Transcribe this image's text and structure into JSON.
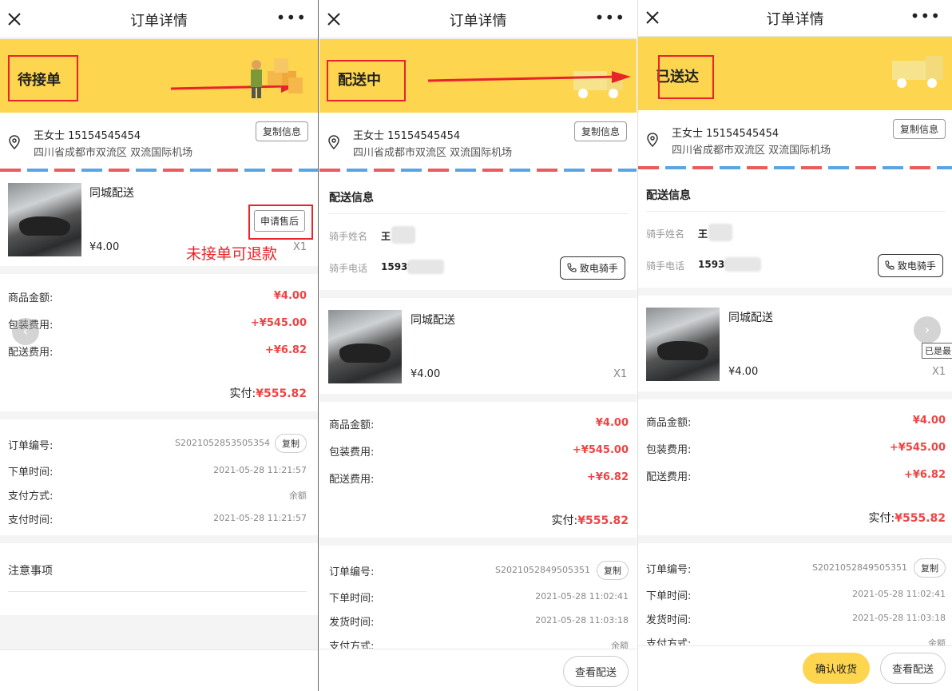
{
  "header": {
    "title": "订单详情",
    "more": "•••"
  },
  "addr": {
    "name": "王女士 15154545454",
    "location": "四川省成都市双流区 双流国际机场",
    "copy_info": "复制信息"
  },
  "product": {
    "name": "同城配送",
    "price": "¥4.00",
    "qty": "X1"
  },
  "amounts": {
    "goods_label": "商品金额:",
    "goods": "¥4.00",
    "pack_label": "包装费用:",
    "pack": "+¥545.00",
    "ship_label": "配送费用:",
    "ship": "+¥6.82",
    "paid_label": "实付:",
    "paid": "¥555.82"
  },
  "labels": {
    "order_no": "订单编号:",
    "order_time": "下单时间:",
    "pay_method": "支付方式:",
    "pay_time": "支付时间:",
    "ship_time": "发货时间:",
    "copy": "复制",
    "delivery_info": "配送信息",
    "rider_name": "骑手姓名",
    "rider_phone": "骑手电话",
    "call_rider": "致电骑手",
    "view_delivery": "查看配送",
    "confirm_receipt": "确认收货",
    "notes": "注意事项"
  },
  "panel1": {
    "status": "待接单",
    "after_sale": "申请售后",
    "annotation": "未接单可退款",
    "order_no": "S2021052853505354",
    "order_time": "2021-05-28 11:21:57",
    "pay_method": "余额",
    "pay_time": "2021-05-28 11:21:57",
    "nav_left": "‹"
  },
  "panel2": {
    "status": "配送中",
    "rider_name": "王",
    "rider_phone": "15939",
    "order_no": "S2021052849505351",
    "order_time": "2021-05-28 11:02:41",
    "ship_time": "2021-05-28 11:03:18",
    "pay_method": "余额"
  },
  "panel3": {
    "status": "已送达",
    "rider_name": "王",
    "rider_phone": "15939",
    "order_no": "S2021052849505351",
    "order_time": "2021-05-28 11:02:41",
    "ship_time": "2021-05-28 11:03:18",
    "pay_method": "余额",
    "nav_right": "›",
    "tooltip": "已是最"
  },
  "colors": {
    "accent_yellow": "#fed54e",
    "annotation_red": "#e8232b",
    "price_red": "#e44"
  }
}
